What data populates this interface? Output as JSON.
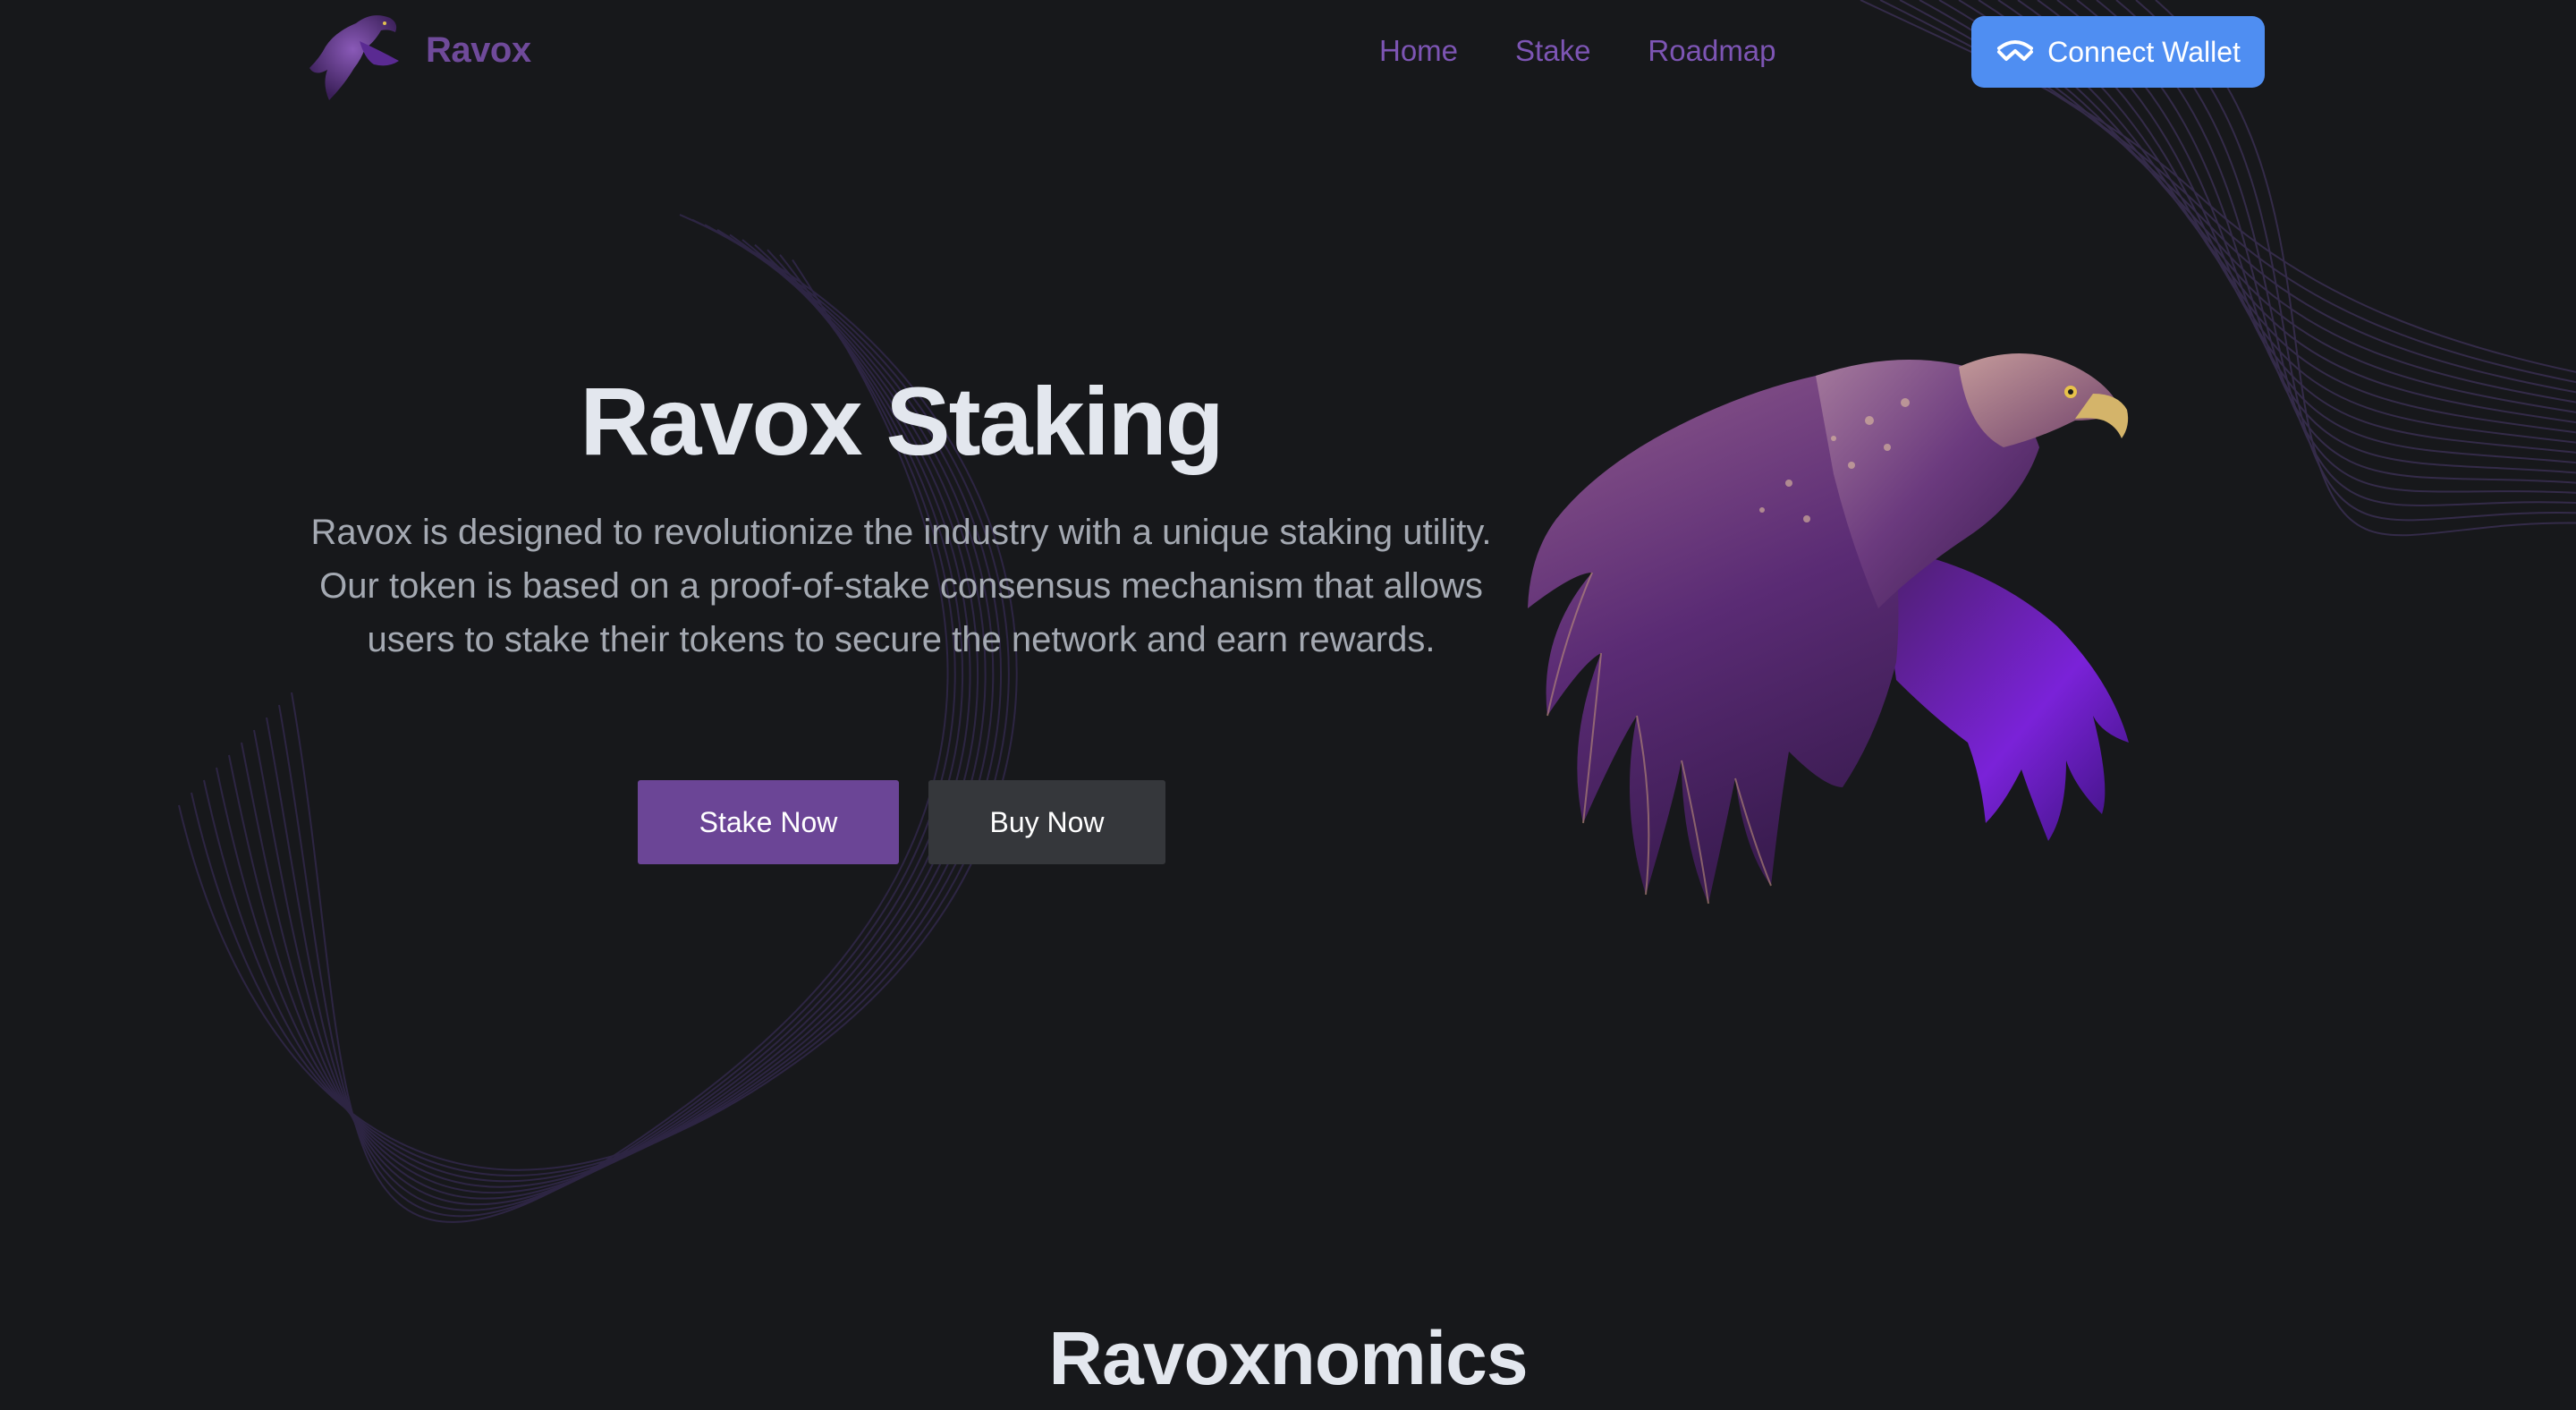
{
  "brand": {
    "name": "Ravox",
    "logo_icon": "eagle-logo-icon"
  },
  "nav": {
    "links": [
      "Home",
      "Stake",
      "Roadmap"
    ],
    "connect_wallet_label": "Connect Wallet",
    "connect_wallet_icon": "walletconnect-icon"
  },
  "hero": {
    "title": "Ravox Staking",
    "description": "Ravox is designed to revolutionize the industry with a unique staking utility. Our token is based on a proof-of-stake consensus mechanism that allows users to stake their tokens to secure the network and earn rewards.",
    "stake_label": "Stake Now",
    "buy_label": "Buy Now",
    "image_icon": "purple-eagle-illustration"
  },
  "sections": {
    "next_title": "Ravoxnomics"
  },
  "colors": {
    "background": "#17181b",
    "brand_purple": "#6f4a9a",
    "nav_link": "#7d55b4",
    "connect_blue": "#4f8ef2",
    "stake_button": "#6b4596",
    "buy_button": "#35373b",
    "heading": "#e3e7ee",
    "body_text": "#a4a9b2"
  }
}
